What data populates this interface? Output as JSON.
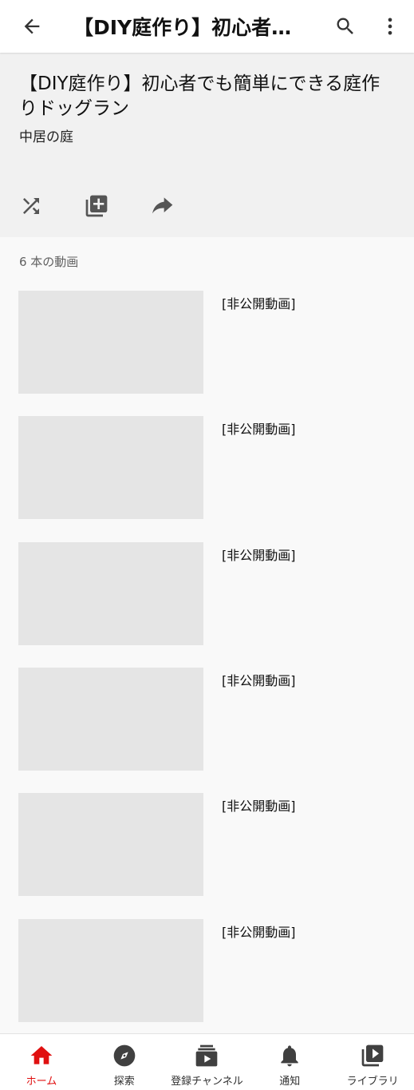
{
  "topbar": {
    "title": "【DIY庭作り】初心者…"
  },
  "playlist": {
    "title": "【DIY庭作り】初心者でも簡単にできる庭作りドッグラン",
    "channel": "中居の庭",
    "video_count": "6 本の動画"
  },
  "videos": [
    {
      "title": "[非公開動画]"
    },
    {
      "title": "[非公開動画]"
    },
    {
      "title": "[非公開動画]"
    },
    {
      "title": "[非公開動画]"
    },
    {
      "title": "[非公開動画]"
    },
    {
      "title": "[非公開動画]"
    }
  ],
  "bottom_nav": [
    {
      "label": "ホーム",
      "icon": "home-icon",
      "active": true
    },
    {
      "label": "探索",
      "icon": "explore-icon",
      "active": false
    },
    {
      "label": "登録チャンネル",
      "icon": "subscriptions-icon",
      "active": false
    },
    {
      "label": "通知",
      "icon": "bell-icon",
      "active": false
    },
    {
      "label": "ライブラリ",
      "icon": "library-icon",
      "active": false
    }
  ],
  "colors": {
    "accent": "#e01010",
    "thumbnail_placeholder": "#e5e5e5",
    "header_bg": "#f1f1f1"
  }
}
